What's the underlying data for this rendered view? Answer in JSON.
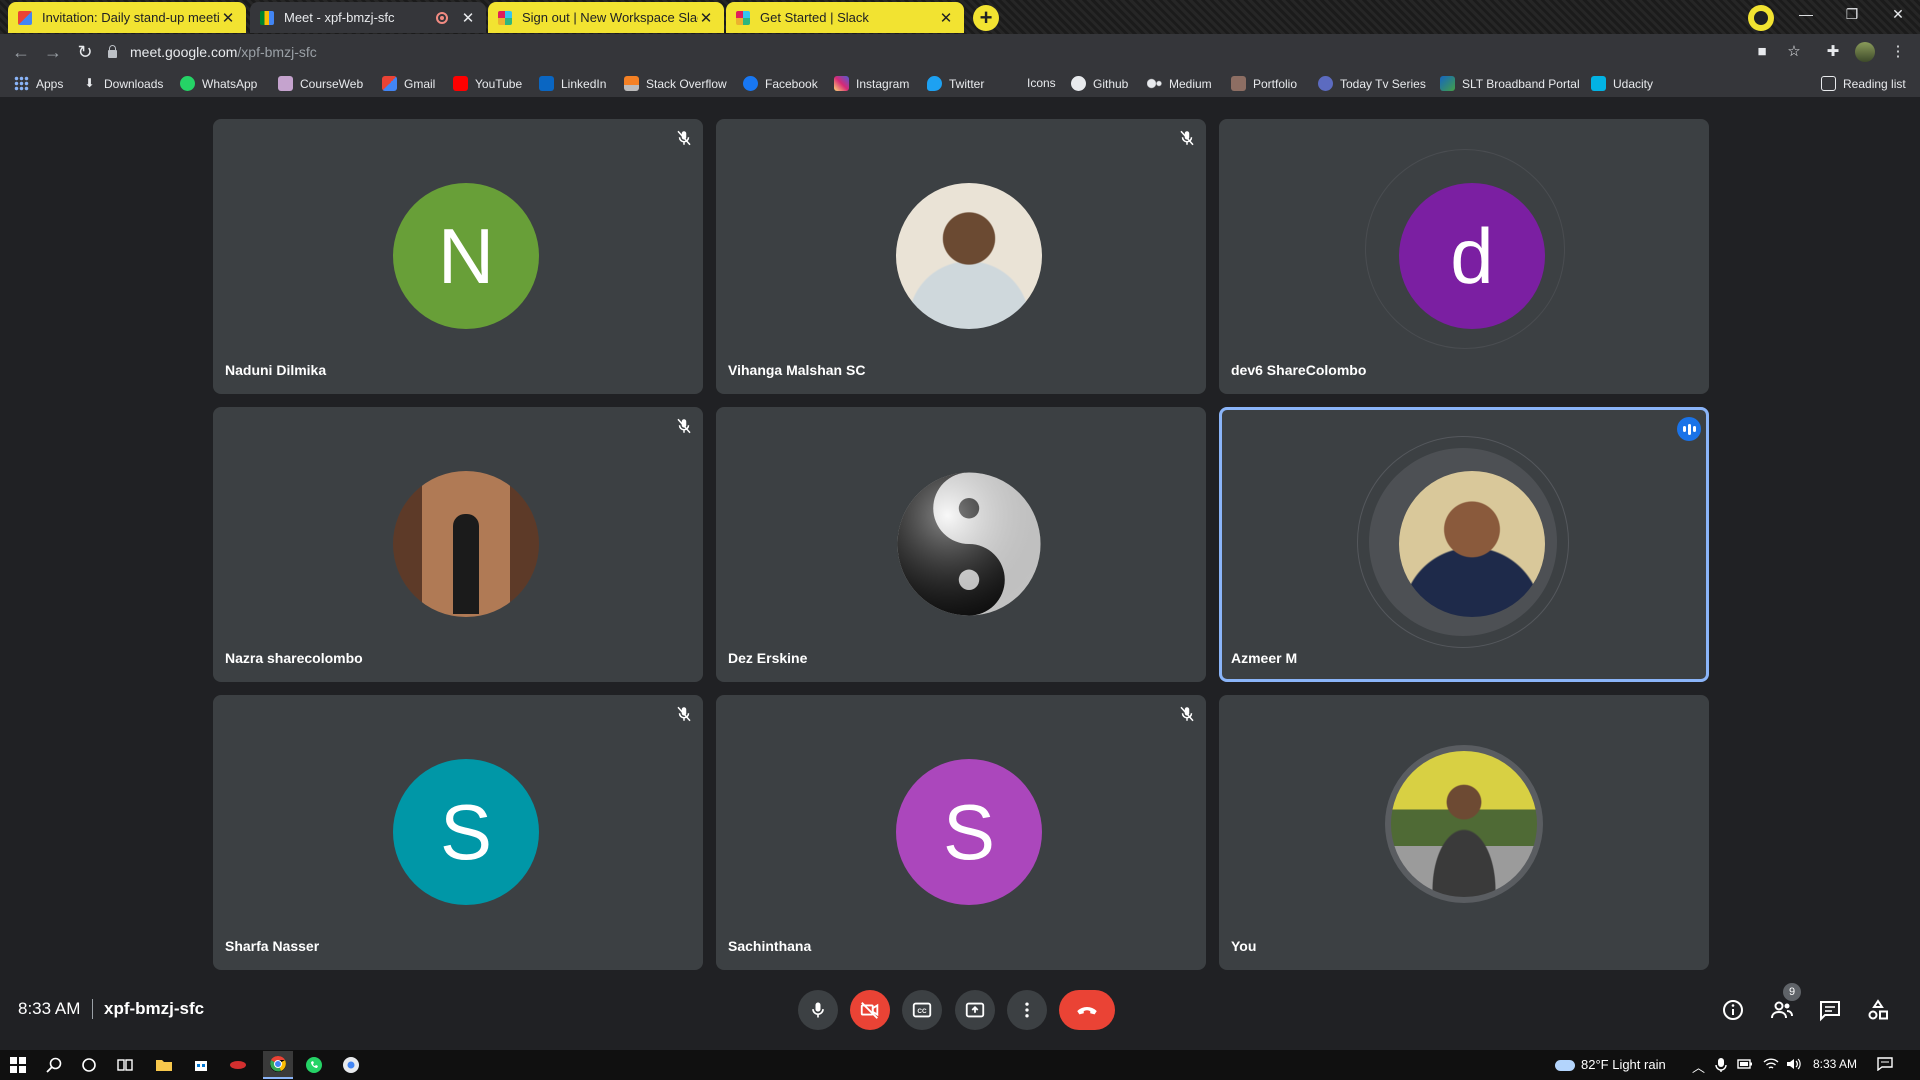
{
  "browser": {
    "tabs": [
      {
        "title": "Invitation: Daily stand-up meetin"
      },
      {
        "title": "Meet - xpf-bmzj-sfc"
      },
      {
        "title": "Sign out | New Workspace Slack"
      },
      {
        "title": "Get Started | Slack"
      }
    ],
    "url_host": "meet.google.com",
    "url_path": "/xpf-bmzj-sfc",
    "bookmarks": [
      "Apps",
      "Downloads",
      "WhatsApp",
      "CourseWeb",
      "Gmail",
      "YouTube",
      "LinkedIn",
      "Stack Overflow",
      "Facebook",
      "Instagram",
      "Twitter",
      "Icons",
      "Github",
      "Medium",
      "Portfolio",
      "Today Tv Series",
      "SLT Broadband Portal",
      "Udacity"
    ],
    "reading_list": "Reading list"
  },
  "participants": [
    {
      "name": "Naduni Dilmika",
      "initial": "N",
      "color": "#689f38",
      "muted": true
    },
    {
      "name": "Vihanga Malshan SC",
      "initial": "",
      "color": "#c8b8a0",
      "muted": true
    },
    {
      "name": "dev6 ShareColombo",
      "initial": "d",
      "color": "#7b1fa2",
      "muted": false
    },
    {
      "name": "Nazra sharecolombo",
      "initial": "",
      "color": "#8d5a3c",
      "muted": true
    },
    {
      "name": "Dez Erskine",
      "initial": "",
      "color": "#ffffff",
      "muted": false
    },
    {
      "name": "Azmeer M",
      "initial": "",
      "color": "#2a3550",
      "muted": false,
      "speaking": true
    },
    {
      "name": "Sharfa Nasser",
      "initial": "S",
      "color": "#0097a7",
      "muted": true
    },
    {
      "name": "Sachinthana",
      "initial": "S",
      "color": "#ab47bc",
      "muted": true
    },
    {
      "name": "You",
      "initial": "",
      "color": "#6b7a45",
      "muted": false
    }
  ],
  "meeting": {
    "time": "8:33 AM",
    "code": "xpf-bmzj-sfc",
    "people_count": "9"
  },
  "taskbar": {
    "weather": "82°F  Light rain",
    "time": "8:33 AM"
  },
  "colors": {
    "accent": "#8ab4f8",
    "danger": "#ea4335",
    "tile": "#3c4043",
    "bg": "#202124"
  }
}
